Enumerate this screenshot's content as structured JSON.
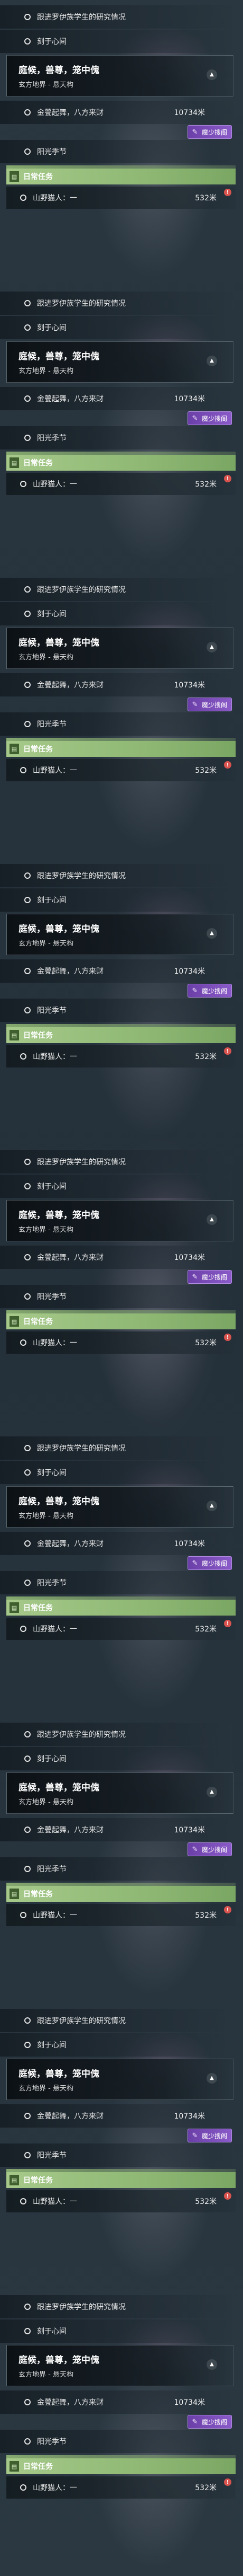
{
  "quest_panel": {
    "item_1": "跟进罗伊族学生的研究情况",
    "item_2": "刻于心间",
    "main_title": "庭候，兽尊，笼中傀",
    "main_subtitle": "玄方地界 - 悬天构",
    "item_3": "金甍起舞，八方来财",
    "item_3_distance": "10734米",
    "badge_label": "魔少搜阁",
    "badge_icon": "feather-icon",
    "item_4": "阳光季节",
    "daily_header": "日常任务",
    "daily_item": "山野猫人：一",
    "daily_item_distance": "532米"
  },
  "colors": {
    "daily_header": "#a6c98a",
    "badge": "#6b3fa8",
    "alert_mark": "#d9534f"
  }
}
